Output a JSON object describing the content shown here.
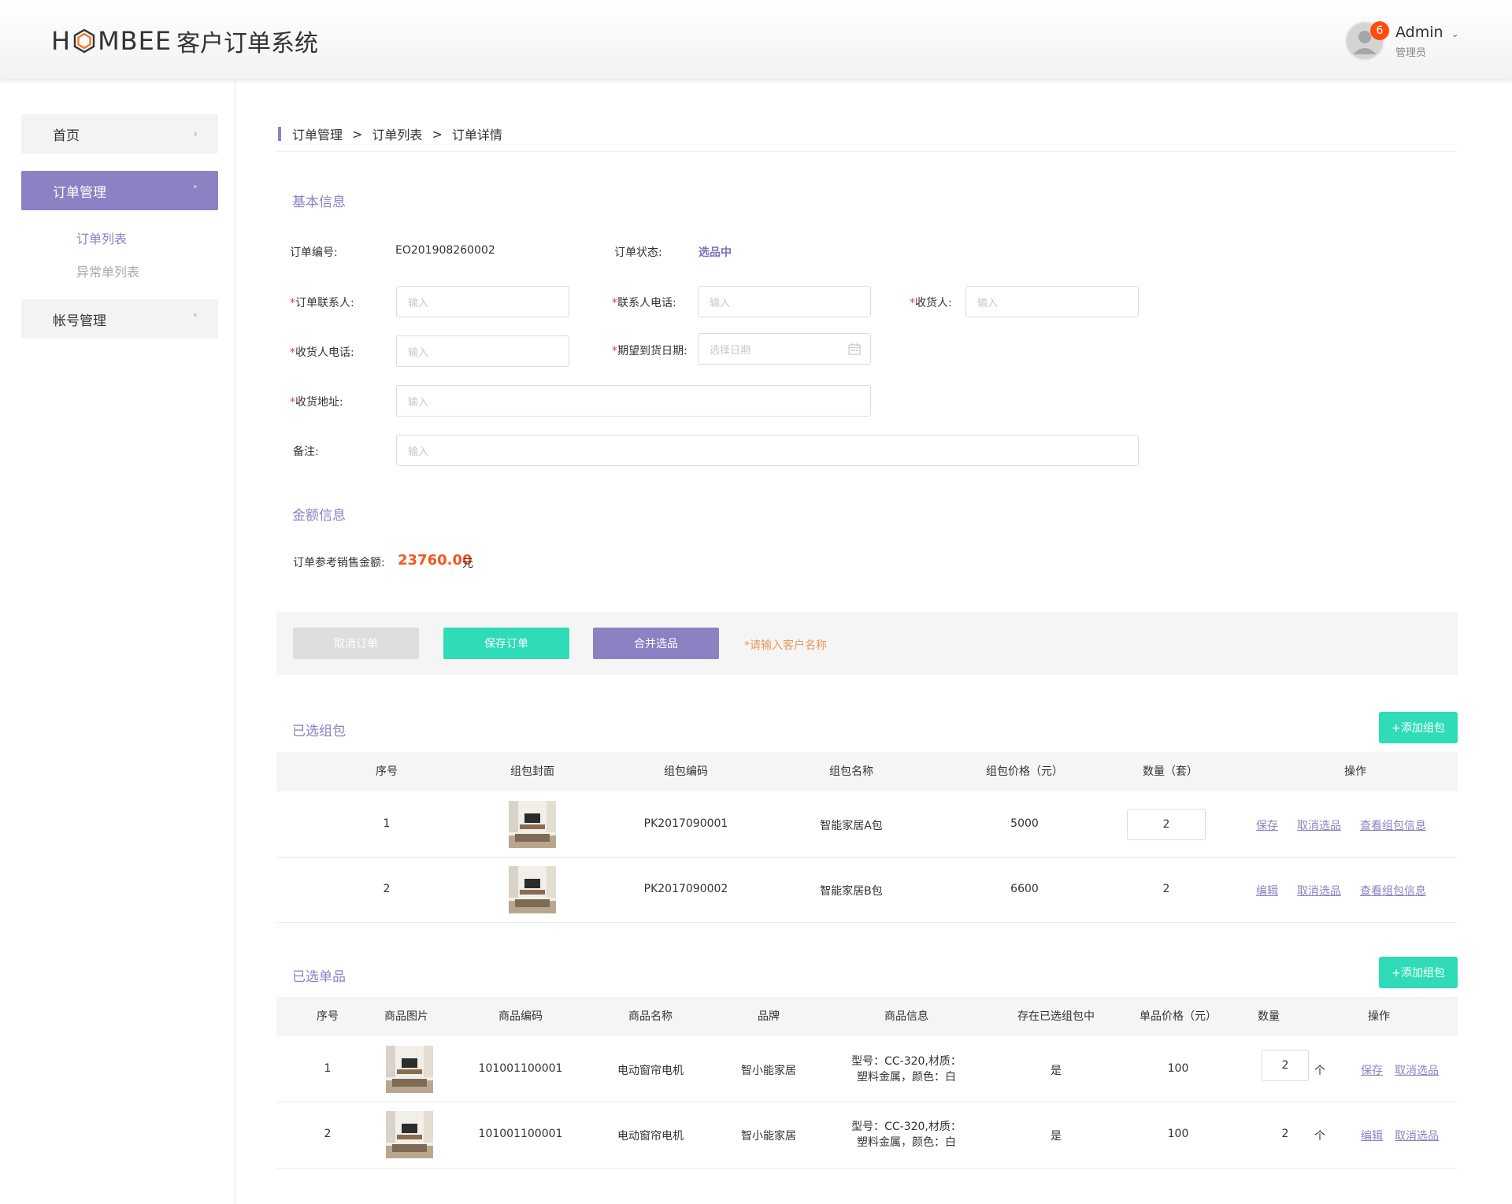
{
  "header": {
    "logo_h": "H",
    "logo_rest": "MBEE",
    "app_title": "客户订单系统",
    "notification_count": "6",
    "user_name": "Admin",
    "user_role": "管理员",
    "colors": {
      "accent": "#8b82c4",
      "teal": "#2fdcb7",
      "badge": "#ff4d0e"
    }
  },
  "sidebar": {
    "home": "首页",
    "order_mgmt": "订单管理",
    "order_list": "订单列表",
    "exception_list": "异常单列表",
    "account_mgmt": "帐号管理"
  },
  "breadcrumb": [
    "订单管理",
    "订单列表",
    "订单详情"
  ],
  "basic_info": {
    "title": "基本信息",
    "order_no_label": "订单编号:",
    "order_no": "EO201908260002",
    "status_label": "订单状态:",
    "status": "选品中",
    "contact_label": "订单联系人:",
    "contact_phone_label": "联系人电话:",
    "receiver_label": "收货人:",
    "receiver_phone_label": "收货人电话:",
    "expected_date_label": "期望到货日期:",
    "address_label": "收货地址:",
    "remark_label": "备注:",
    "input_placeholder": "输入",
    "date_placeholder": "选择日期",
    "required_mark": "*"
  },
  "amount_info": {
    "title": "金额信息",
    "label": "订单参考销售金额:",
    "value": "23760.00",
    "unit": "元"
  },
  "actions": {
    "cancel_order": "取消订单",
    "save_order": "保存订单",
    "merge": "合并选品",
    "hint": "*请输入客户名称"
  },
  "packages": {
    "title": "已选组包",
    "add_button": "+添加组包",
    "columns": [
      "序号",
      "组包封面",
      "组包编码",
      "组包名称",
      "组包价格（元）",
      "数量（套）",
      "操作"
    ],
    "rows": [
      {
        "index": "1",
        "code": "PK2017090001",
        "name": "智能家居A包",
        "price": "5000",
        "qty": "2",
        "action1": "保存",
        "action2": "取消选品",
        "action3": "查看组包信息"
      },
      {
        "index": "2",
        "code": "PK2017090002",
        "name": "智能家居B包",
        "price": "6600",
        "qty": "2",
        "action1": "编辑",
        "action2": "取消选品",
        "action3": "查看组包信息"
      }
    ]
  },
  "items": {
    "title": "已选单品",
    "add_button": "+添加组包",
    "columns": [
      "序号",
      "商品图片",
      "商品编码",
      "商品名称",
      "品牌",
      "商品信息",
      "存在已选组包中",
      "单品价格（元）",
      "数量",
      "操作"
    ],
    "rows": [
      {
        "index": "1",
        "code": "101001100001",
        "name": "电动窗帘电机",
        "brand": "智小能家居",
        "info1": "型号：CC-320,材质：",
        "info2": "塑料金属，颜色：白",
        "in_package": "是",
        "price": "100",
        "qty": "2",
        "unit": "个",
        "action1": "保存",
        "action2": "取消选品"
      },
      {
        "index": "2",
        "code": "101001100001",
        "name": "电动窗帘电机",
        "brand": "智小能家居",
        "info1": "型号：CC-320,材质：",
        "info2": "塑料金属，颜色：白",
        "in_package": "是",
        "price": "100",
        "qty": "2",
        "unit": "个",
        "action1": "编辑",
        "action2": "取消选品"
      }
    ]
  }
}
